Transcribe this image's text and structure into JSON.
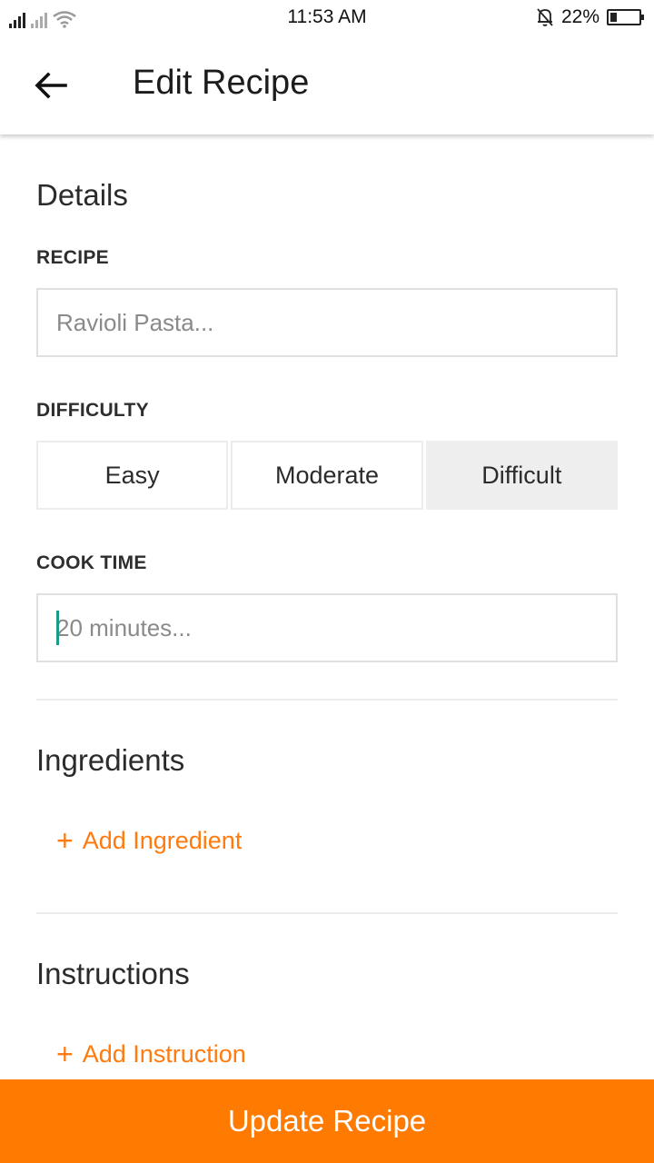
{
  "status_bar": {
    "time": "11:53 AM",
    "battery_percent": "22%",
    "battery_level": 0.22,
    "icons": [
      "signal-icon",
      "signal-icon",
      "wifi-icon",
      "bell-off-icon",
      "battery-icon"
    ]
  },
  "app_bar": {
    "title": "Edit Recipe",
    "back_icon": "arrow-left-icon"
  },
  "details": {
    "title": "Details",
    "recipe_label": "RECIPE",
    "recipe_value": "",
    "recipe_placeholder": "Ravioli Pasta...",
    "difficulty_label": "DIFFICULTY",
    "difficulty_options": [
      "Easy",
      "Moderate",
      "Difficult"
    ],
    "difficulty_selected": "Difficult",
    "cook_time_label": "COOK TIME",
    "cook_time_value": "",
    "cook_time_placeholder": "20 minutes..."
  },
  "ingredients": {
    "title": "Ingredients",
    "add_label": "Add Ingredient",
    "add_icon": "plus-icon"
  },
  "instructions": {
    "title": "Instructions",
    "add_label": "Add Instruction",
    "add_icon": "plus-icon"
  },
  "footer": {
    "submit_label": "Update Recipe"
  },
  "colors": {
    "accent": "#ff7a00",
    "link": "#ff7b0f",
    "caret": "#1a9b8a",
    "selected_segment": "#eeeeee"
  }
}
